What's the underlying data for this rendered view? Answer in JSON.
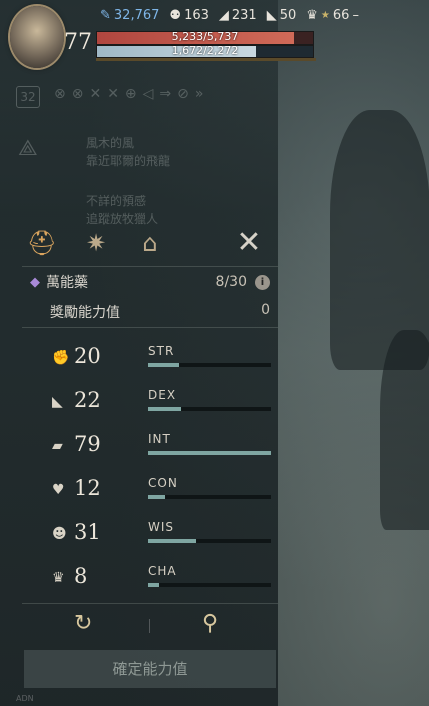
{
  "hud": {
    "level": "77",
    "gems": "32,767",
    "stat_a": "163",
    "stat_b": "231",
    "stat_c": "50",
    "rank": "66",
    "rank_suffix": "–",
    "hp_text": "5,233/5,737",
    "hp_fraction": 0.912,
    "mp_text": "1,672/2,272",
    "mp_fraction": 0.736
  },
  "background": {
    "slot_level": "32",
    "quest1_title": "風木的風",
    "quest1_desc": "靠近耶爾的飛龍",
    "quest2_title": "不詳的預感",
    "quest2_desc": "追蹤放牧獵人"
  },
  "window": {
    "tabs": [
      {
        "name": "helmet",
        "icon": "⛑"
      },
      {
        "name": "compass",
        "icon": "✷"
      },
      {
        "name": "house",
        "icon": "⌂"
      }
    ],
    "close_icon": "✕",
    "potion_label": "萬能藥",
    "potion_count": "8/30",
    "info": "i",
    "bonus_label": "獎勵能力值",
    "bonus_value": "0",
    "stats": [
      {
        "value": "20",
        "abbr": "STR",
        "icon": "strength-icon",
        "fill": 0.25
      },
      {
        "value": "22",
        "abbr": "DEX",
        "icon": "dexterity-icon",
        "fill": 0.27
      },
      {
        "value": "79",
        "abbr": "INT",
        "icon": "intelligence-icon",
        "fill": 1.0
      },
      {
        "value": "12",
        "abbr": "CON",
        "icon": "constitution-icon",
        "fill": 0.14
      },
      {
        "value": "31",
        "abbr": "WIS",
        "icon": "wisdom-icon",
        "fill": 0.39
      },
      {
        "value": "8",
        "abbr": "CHA",
        "icon": "charisma-icon",
        "fill": 0.09
      }
    ],
    "confirm_label": "確定能力值",
    "corner_text": "ADN"
  },
  "colors": {
    "hp": "#c2564a",
    "mp": "#b8ccd6",
    "stat_bar": "#7fa6a2",
    "accent": "#d9a45e"
  }
}
